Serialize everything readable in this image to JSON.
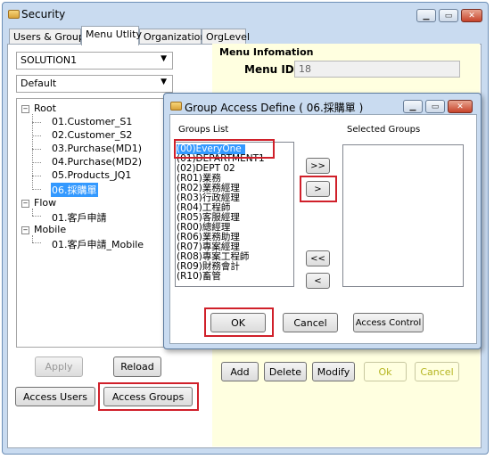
{
  "window": {
    "title": "Security"
  },
  "tabs": [
    "Users & Groups",
    "Menu Utlity",
    "Organization",
    "OrgLevel"
  ],
  "left": {
    "solution_combo": "SOLUTION1",
    "default_combo": "Default",
    "tree": {
      "root": "Root",
      "root_children": [
        "01.Customer_S1",
        "02.Customer_S2",
        "03.Purchase(MD1)",
        "04.Purchase(MD2)",
        "05.Products_JQ1",
        "06.採購單"
      ],
      "flow": "Flow",
      "flow_children": [
        "01.客戶申請"
      ],
      "mobile": "Mobile",
      "mobile_children": [
        "01.客戶申請_Mobile"
      ]
    },
    "apply_label": "Apply",
    "reload_label": "Reload",
    "access_users_label": "Access Users",
    "access_groups_label": "Access Groups"
  },
  "info": {
    "title": "Menu Infomation",
    "menu_id_label": "Menu ID",
    "menu_id_value": "18"
  },
  "bottom_buttons": {
    "add": "Add",
    "delete": "Delete",
    "modify": "Modify",
    "ok": "Ok",
    "cancel": "Cancel"
  },
  "dialog": {
    "title": "Group Access Define ( 06.採購單 )",
    "groups_list_label": "Groups List",
    "selected_groups_label": "Selected Groups",
    "groups": [
      "(00)EveryOne",
      "(01)DEPARTMENT1",
      "(02)DEPT 02",
      "(R01)業務",
      "(R02)業務經理",
      "(R03)行政經理",
      "(R04)工程師",
      "(R05)客服經理",
      "(R00)總經理",
      "(R06)業務助理",
      "(R07)專案經理",
      "(R08)專案工程師",
      "(R09)財務會計",
      "(R10)畜管"
    ],
    "selected_groups": [],
    "add_all_label": ">>",
    "add_label": ">",
    "remove_all_label": "<<",
    "remove_label": "<",
    "ok_label": "OK",
    "cancel_label": "Cancel",
    "access_control_label": "Access Control"
  },
  "colors": {
    "highlight": "#d0202a",
    "selection": "#3399ff",
    "panel": "#ffffe0",
    "chrome": "#c9dbf0"
  }
}
